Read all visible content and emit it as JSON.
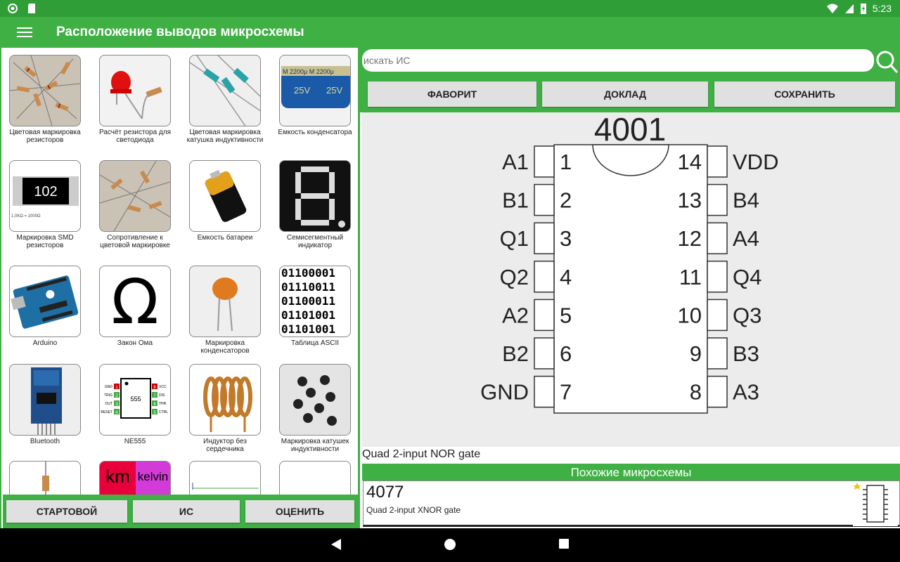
{
  "status_bar": {
    "time": "5:23"
  },
  "app_bar": {
    "title": "Расположение выводов микросхемы"
  },
  "tools": [
    {
      "label": "Цветовая маркировка резисторов"
    },
    {
      "label": "Расчёт резистора для светодиода"
    },
    {
      "label": "Цветовая маркировка катушка индуктивности"
    },
    {
      "label": "Емкость конденсатора"
    },
    {
      "label": "Маркировка SMD резисторов"
    },
    {
      "label": "Сопротивление к цветовой маркировке"
    },
    {
      "label": "Емкость батареи"
    },
    {
      "label": "Семисегментный индикатор"
    },
    {
      "label": "Arduino"
    },
    {
      "label": "Закон Ома"
    },
    {
      "label": "Маркировка конденсаторов"
    },
    {
      "label": "Таблица ASCII"
    },
    {
      "label": "Bluetooth"
    },
    {
      "label": "NE555"
    },
    {
      "label": "Индуктор без сердечника"
    },
    {
      "label": "Маркировка катушек индуктивности"
    }
  ],
  "thumb_text": {
    "smd_code": "102",
    "smd_note": "1,0KΩ = 1000Ω",
    "capacitor": "M 2200μ M 2200μ",
    "cap_voltage": "25V",
    "ohm_symbol": "Ω",
    "ascii_lines": [
      "01100001",
      "01110011",
      "01100011",
      "01101001",
      "01101001"
    ],
    "ne555_label": "555",
    "ne555_left": [
      "GND",
      "TRIG",
      "OUT",
      "RESET"
    ],
    "ne555_right": [
      "VCC",
      "DIS",
      "THR",
      "CTRL"
    ],
    "ne555_left_nums": [
      "1",
      "2",
      "3",
      "4"
    ],
    "ne555_right_nums": [
      "8",
      "7",
      "6",
      "5"
    ],
    "km_text": "km",
    "kelvin_text": "kelvin"
  },
  "bottom_buttons": {
    "start": "СТАРТОВОЙ",
    "ic": "ИС",
    "rate": "ОЦЕНИТЬ"
  },
  "search": {
    "placeholder": "искать ИС"
  },
  "actions": {
    "favorite": "ФАВОРИТ",
    "report": "ДОКЛАД",
    "save": "СОХРАНИТЬ"
  },
  "chip": {
    "number": "4001",
    "description": "Quad 2-input NOR gate",
    "left_pins": [
      {
        "name": "A1",
        "num": "1"
      },
      {
        "name": "B1",
        "num": "2"
      },
      {
        "name": "Q1",
        "num": "3"
      },
      {
        "name": "Q2",
        "num": "4"
      },
      {
        "name": "A2",
        "num": "5"
      },
      {
        "name": "B2",
        "num": "6"
      },
      {
        "name": "GND",
        "num": "7"
      }
    ],
    "right_pins": [
      {
        "name": "VDD",
        "num": "14"
      },
      {
        "name": "B4",
        "num": "13"
      },
      {
        "name": "A4",
        "num": "12"
      },
      {
        "name": "Q4",
        "num": "11"
      },
      {
        "name": "Q3",
        "num": "10"
      },
      {
        "name": "B3",
        "num": "9"
      },
      {
        "name": "A3",
        "num": "8"
      }
    ]
  },
  "similar": {
    "heading": "Похожие микросхемы",
    "items": [
      {
        "number": "4077",
        "description": "Quad 2-input XNOR gate"
      }
    ]
  },
  "colors": {
    "primary": "#3fb044",
    "status": "#2f9e37"
  }
}
